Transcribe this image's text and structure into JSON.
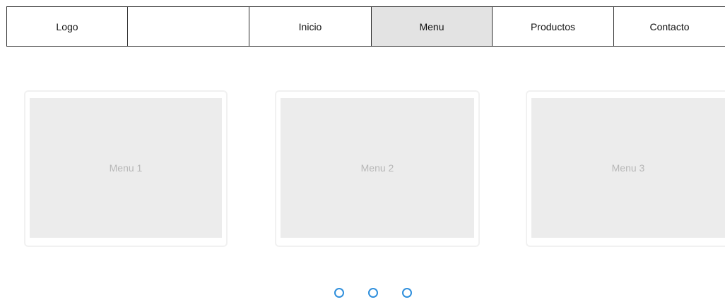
{
  "nav": {
    "logo": "Logo",
    "blank": "",
    "items": [
      {
        "label": "Inicio"
      },
      {
        "label": "Menu",
        "active": true
      },
      {
        "label": "Productos"
      },
      {
        "label": "Contacto"
      }
    ]
  },
  "cards": [
    {
      "label": "Menu 1"
    },
    {
      "label": "Menu 2"
    },
    {
      "label": "Menu 3"
    }
  ],
  "pagination": {
    "count": 3,
    "accent_color": "#2f8fdc"
  },
  "colors": {
    "active_nav_bg": "#e3e3e3",
    "card_placeholder_bg": "#ececec",
    "card_label": "#b7b7b7"
  }
}
